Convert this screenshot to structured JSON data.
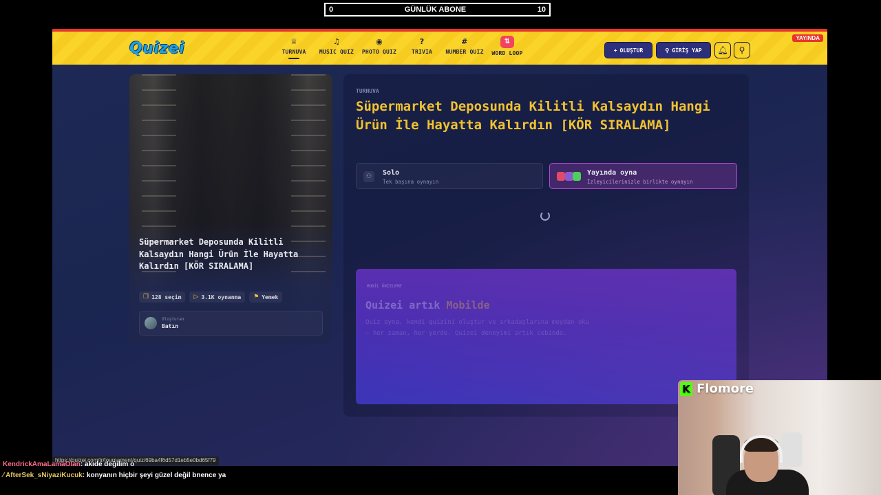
{
  "counter": {
    "left": "0",
    "label": "GÜNLÜK ABONE",
    "right": "10"
  },
  "header": {
    "logo": "Quizei",
    "nav": [
      {
        "label": "TURNUVA",
        "icon": "trophy-icon",
        "glyph": "♕",
        "active": true
      },
      {
        "label": "MUSIC QUIZ",
        "icon": "music-note-icon",
        "glyph": "♫"
      },
      {
        "label": "PHOTO QUIZ",
        "icon": "camera-icon",
        "glyph": "◉"
      },
      {
        "label": "TRIVIA",
        "icon": "question-icon",
        "glyph": "?"
      },
      {
        "label": "NUMBER QUIZ",
        "icon": "hash-icon",
        "glyph": "#"
      },
      {
        "label": "WORD LOOP",
        "icon": "shuffle-icon",
        "glyph": "⇅"
      }
    ],
    "create_label": "OLUŞTUR",
    "login_label": "GİRİŞ YAP",
    "live_badge": "YAYINDA"
  },
  "card": {
    "title": "Süpermarket Deposunda Kilitli Kalsaydın Hangi Ürün İle Hayatta Kalırdın [KÖR SIRALAMA]",
    "choices": "128 seçim",
    "plays": "3.1K oynanma",
    "category": "Yemek",
    "creator_label": "Oluşturan",
    "creator_name": "Batın"
  },
  "panel": {
    "eyebrow": "TURNUVA",
    "title": "Süpermarket Deposunda Kilitli Kalsaydın Hangi Ürün İle Hayatta Kalırdın [KÖR SIRALAMA]",
    "modes": [
      {
        "label": "Solo",
        "sub": "Tek başına oynayın"
      },
      {
        "label": "Yayında oyna",
        "sub": "İzleyicilerinizle birlikte oynayın"
      }
    ]
  },
  "promo": {
    "tag": "MOBİL ÖNİZLEME",
    "title_prefix": "Quizei artık ",
    "title_highlight": "Mobilde",
    "text": "Quiz oyna, kendi quizini oluştur ve arkadaşlarına meydan oku — her zaman, her yerde. Quizei deneyimi artık cebinde."
  },
  "url_tip": "https://quizei.com/tr/tournament/quiz/69ba4f6d57d1eb5e0bd65f79",
  "webcam": {
    "name": "Flomore"
  },
  "chat": [
    {
      "user": "KendrickAmaLamaOlan",
      "text": ": akıde değilim o"
    },
    {
      "user": "AfterSek_sNiyaziKucuk",
      "text": ": konyanın hiçbir şeyi güzel değil bnence ya"
    }
  ],
  "colors": {
    "accent": "#f2c230",
    "header": "#fbd42a",
    "live": "#e8342a",
    "kick": "#53fc18"
  }
}
